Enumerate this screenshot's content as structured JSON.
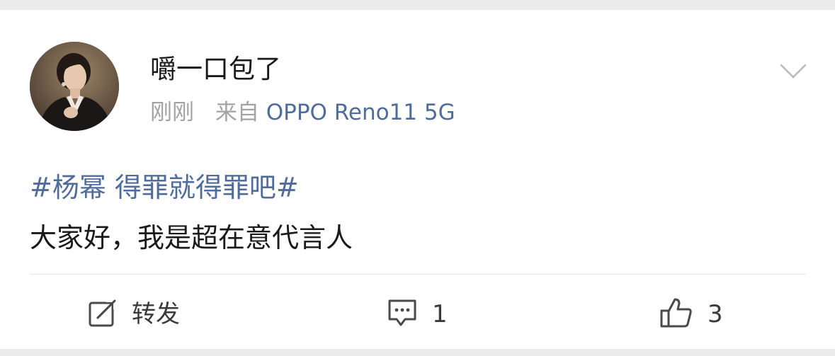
{
  "post": {
    "username": "嚼一口包了",
    "time": "刚刚",
    "source_prefix": "来自",
    "device": "OPPO Reno11 5G",
    "topic": "#杨幂 得罪就得罪吧#",
    "text": "大家好，我是超在意代言人"
  },
  "actions": {
    "repost_label": "转发",
    "comment_count": "1",
    "like_count": "3"
  },
  "colors": {
    "link": "#4f6c9b",
    "meta": "#a3a3a3",
    "text": "#1a1a1a",
    "background": "#ececec",
    "card": "#ffffff"
  },
  "icons": {
    "avatar": "user-avatar",
    "more": "chevron-down-icon",
    "repost": "share-icon",
    "comment": "comment-icon",
    "like": "thumbs-up-icon"
  }
}
